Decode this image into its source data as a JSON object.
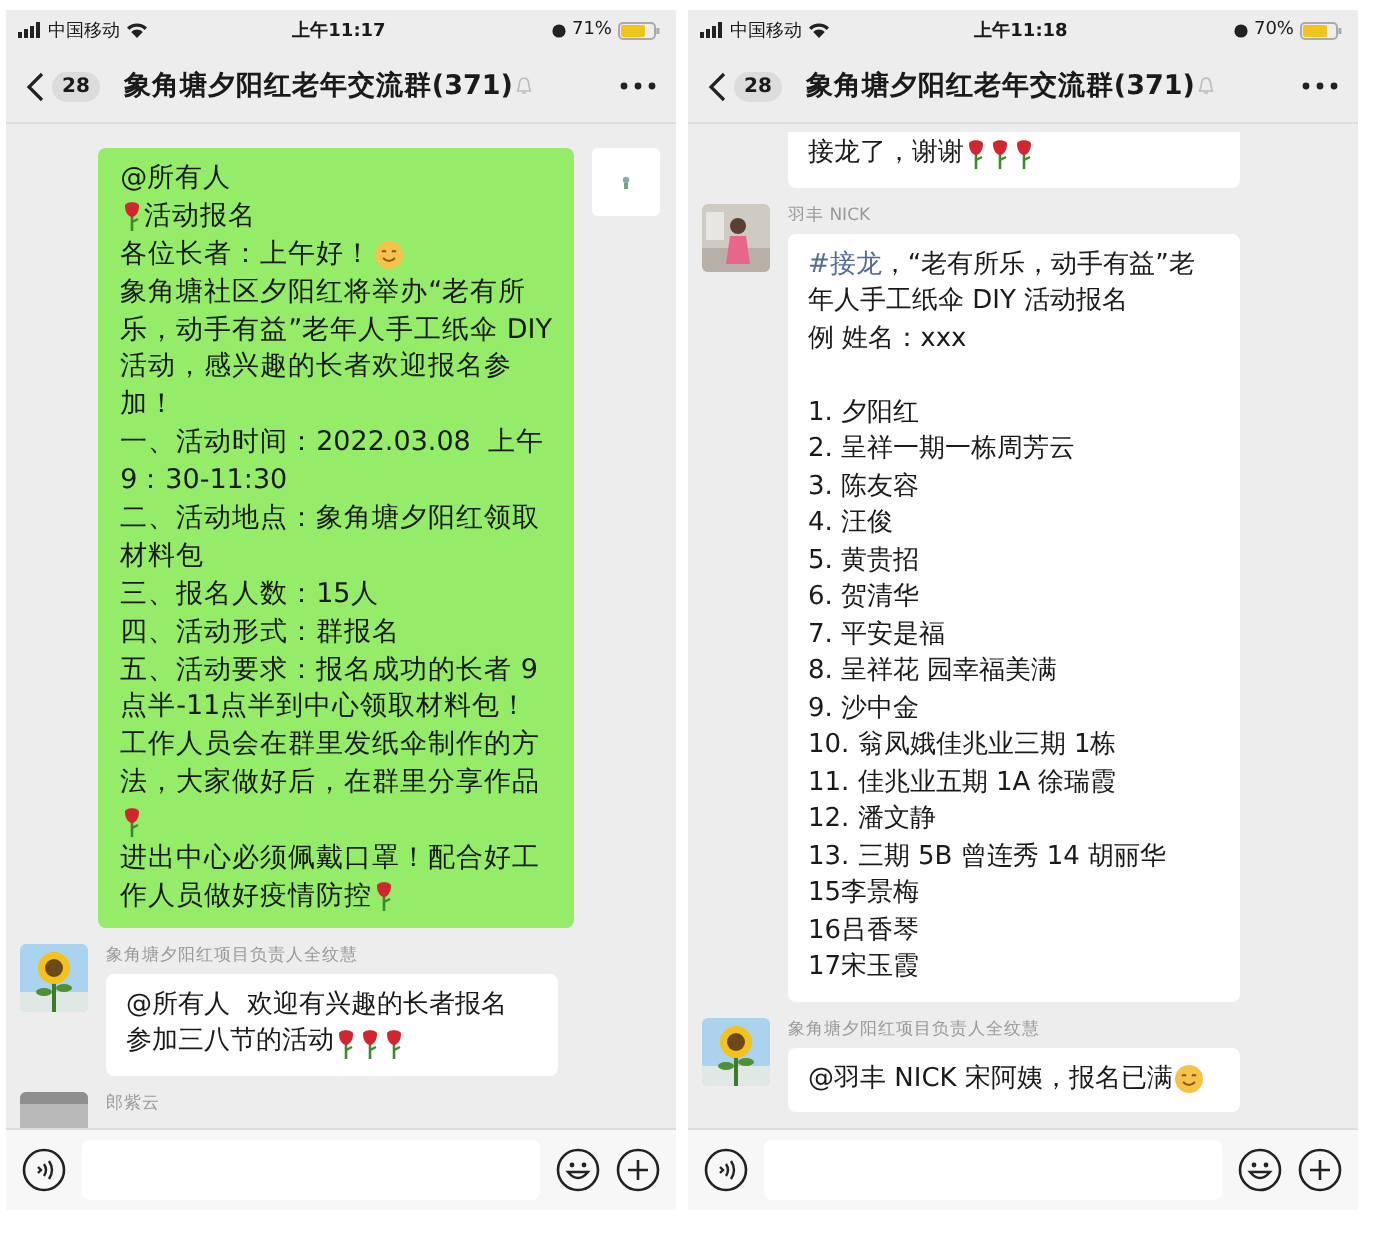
{
  "phones": [
    {
      "status_bar": {
        "carrier": "中国移动",
        "time": "上午11:17",
        "battery": "71%"
      },
      "nav": {
        "badge": "28",
        "title": "象角塘夕阳红老年交流群(371)"
      },
      "messages": [
        {
          "kind": "own",
          "lines": [
            {
              "parts": [
                {
                  "kind": "text",
                  "text": "@所有人"
                }
              ]
            },
            {
              "parts": [
                {
                  "kind": "rose"
                },
                {
                  "kind": "text",
                  "text": "活动报名"
                }
              ]
            },
            {
              "parts": [
                {
                  "kind": "text",
                  "text": "各位长者：上午好！"
                },
                {
                  "kind": "smile"
                }
              ]
            },
            {
              "parts": [
                {
                  "kind": "text",
                  "text": "象角塘社区夕阳红将举办“老有所"
                }
              ]
            },
            {
              "parts": [
                {
                  "kind": "text",
                  "text": "乐，动手有益”老年人手工纸伞 DIY"
                }
              ]
            },
            {
              "parts": [
                {
                  "kind": "text",
                  "text": "活动，感兴趣的长者欢迎报名参"
                }
              ]
            },
            {
              "parts": [
                {
                  "kind": "text",
                  "text": "加！"
                }
              ]
            },
            {
              "parts": [
                {
                  "kind": "text",
                  "text": "一、活动时间：2022.03.08  上午"
                }
              ]
            },
            {
              "parts": [
                {
                  "kind": "text",
                  "text": "9：30-11:30"
                }
              ]
            },
            {
              "parts": [
                {
                  "kind": "text",
                  "text": "二、活动地点：象角塘夕阳红领取"
                }
              ]
            },
            {
              "parts": [
                {
                  "kind": "text",
                  "text": "材料包"
                }
              ]
            },
            {
              "parts": [
                {
                  "kind": "text",
                  "text": "三、报名人数：15人"
                }
              ]
            },
            {
              "parts": [
                {
                  "kind": "text",
                  "text": "四、活动形式：群报名"
                }
              ]
            },
            {
              "parts": [
                {
                  "kind": "text",
                  "text": "五、活动要求：报名成功的长者 9"
                }
              ]
            },
            {
              "parts": [
                {
                  "kind": "text",
                  "text": "点半-11点半到中心领取材料包！"
                }
              ]
            },
            {
              "parts": [
                {
                  "kind": "text",
                  "text": "工作人员会在群里发纸伞制作的方"
                }
              ]
            },
            {
              "parts": [
                {
                  "kind": "text",
                  "text": "法，大家做好后，在群里分享作品"
                }
              ]
            },
            {
              "parts": [
                {
                  "kind": "rose"
                }
              ]
            },
            {
              "parts": [
                {
                  "kind": "text",
                  "text": "进出中心必须佩戴口罩！配合好工"
                }
              ]
            },
            {
              "parts": [
                {
                  "kind": "text",
                  "text": "作人员做好疫情防控"
                },
                {
                  "kind": "rose"
                }
              ]
            }
          ]
        },
        {
          "kind": "other",
          "sender": "象角塘夕阳红项目负责人全纹慧",
          "lines": [
            {
              "parts": [
                {
                  "kind": "text",
                  "text": "@所有人  欢迎有兴趣的长者报名"
                }
              ]
            },
            {
              "parts": [
                {
                  "kind": "text",
                  "text": "参加三八节的活动"
                },
                {
                  "kind": "rose"
                },
                {
                  "kind": "rose"
                },
                {
                  "kind": "rose"
                }
              ]
            }
          ]
        },
        {
          "kind": "other",
          "sender": "郎紫云"
        }
      ]
    },
    {
      "status_bar": {
        "carrier": "中国移动",
        "time": "上午11:18",
        "battery": "70%"
      },
      "nav": {
        "badge": "28",
        "title": "象角塘夕阳红老年交流群(371)"
      },
      "messages": [
        {
          "kind": "cut",
          "lines": [
            {
              "parts": [
                {
                  "kind": "text",
                  "text": "接龙了，谢谢"
                },
                {
                  "kind": "rose"
                },
                {
                  "kind": "rose"
                },
                {
                  "kind": "rose"
                }
              ]
            }
          ]
        },
        {
          "kind": "other",
          "sender": "羽丰 NICK",
          "lines": [
            {
              "parts": [
                {
                  "kind": "link",
                  "text": "#接龙"
                },
                {
                  "kind": "text",
                  "text": "，“老有所乐，动手有益”老"
                }
              ]
            },
            {
              "parts": [
                {
                  "kind": "text",
                  "text": "年人手工纸伞 DIY 活动报名"
                }
              ]
            },
            {
              "parts": [
                {
                  "kind": "text",
                  "text": "例 姓名：xxx"
                }
              ]
            },
            {
              "gap_before": true,
              "parts": [
                {
                  "kind": "text",
                  "text": "1. 夕阳红"
                }
              ]
            },
            {
              "parts": [
                {
                  "kind": "text",
                  "text": "2. 呈祥一期一栋周芳云"
                }
              ]
            },
            {
              "parts": [
                {
                  "kind": "text",
                  "text": "3. 陈友容"
                }
              ]
            },
            {
              "parts": [
                {
                  "kind": "text",
                  "text": "4. 汪俊"
                }
              ]
            },
            {
              "parts": [
                {
                  "kind": "text",
                  "text": "5. 黄贵招"
                }
              ]
            },
            {
              "parts": [
                {
                  "kind": "text",
                  "text": "6. 贺清华"
                }
              ]
            },
            {
              "parts": [
                {
                  "kind": "text",
                  "text": "7. 平安是福"
                }
              ]
            },
            {
              "parts": [
                {
                  "kind": "text",
                  "text": "8. 呈祥花 园幸福美满"
                }
              ]
            },
            {
              "parts": [
                {
                  "kind": "text",
                  "text": "9. 沙中金"
                }
              ]
            },
            {
              "parts": [
                {
                  "kind": "text",
                  "text": "10. 翁凤娥佳兆业三期 1栋"
                }
              ]
            },
            {
              "parts": [
                {
                  "kind": "text",
                  "text": "11. 佳兆业五期 1A 徐瑞霞"
                }
              ]
            },
            {
              "parts": [
                {
                  "kind": "text",
                  "text": "12. 潘文静"
                }
              ]
            },
            {
              "parts": [
                {
                  "kind": "text",
                  "text": "13. 三期 5B 曾连秀 14 胡丽华"
                }
              ]
            },
            {
              "parts": [
                {
                  "kind": "text",
                  "text": "15李景梅"
                }
              ]
            },
            {
              "parts": [
                {
                  "kind": "text",
                  "text": "16吕香琴"
                }
              ]
            },
            {
              "parts": [
                {
                  "kind": "text",
                  "text": "17宋玉霞"
                }
              ]
            }
          ]
        },
        {
          "kind": "other",
          "sender": "象角塘夕阳红项目负责人全纹慧",
          "lines": [
            {
              "parts": [
                {
                  "kind": "text",
                  "text": "@羽丰 NICK 宋阿姨，报名已满"
                },
                {
                  "kind": "smile"
                }
              ]
            }
          ]
        }
      ]
    }
  ]
}
